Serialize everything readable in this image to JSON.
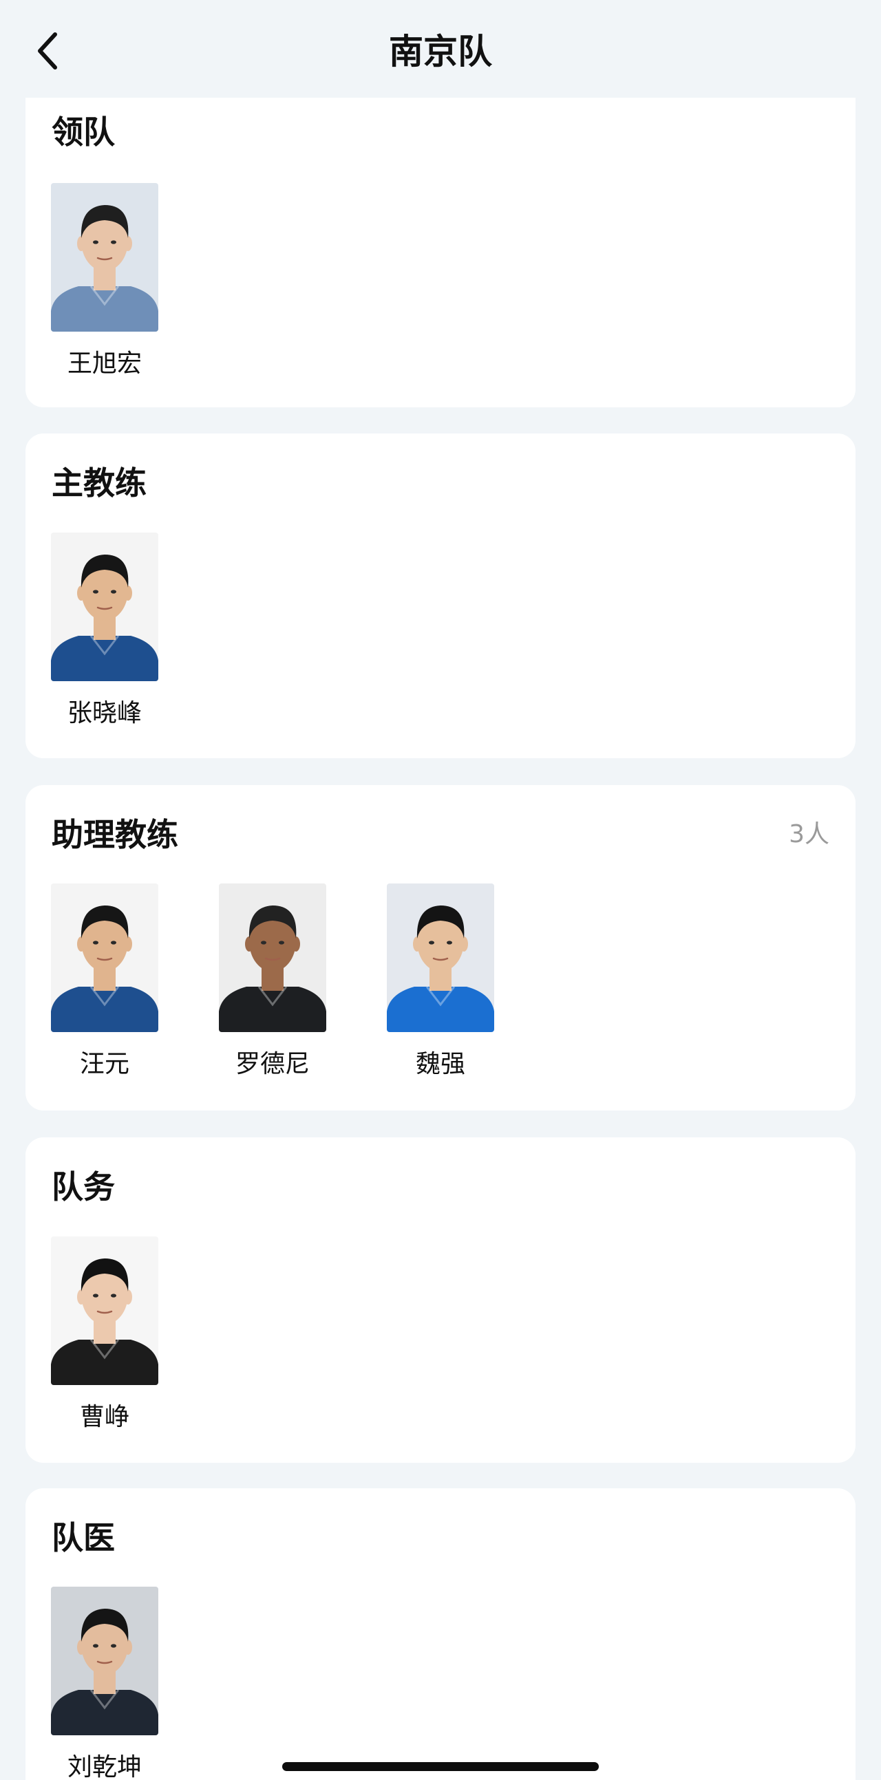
{
  "nav": {
    "title": "南京队",
    "back_icon": "back-arrow-icon"
  },
  "sections": [
    {
      "title": "领队",
      "count": "",
      "members": [
        {
          "name": "王旭宏",
          "bg": "#dde4ec",
          "shirt": "#6f8fb8",
          "hair": "#1f1f1f",
          "skin": "#e8c4a8"
        }
      ]
    },
    {
      "title": "主教练",
      "count": "",
      "members": [
        {
          "name": "张晓峰",
          "bg": "#f4f4f4",
          "shirt": "#1e4f8f",
          "hair": "#161616",
          "skin": "#e2b791"
        }
      ]
    },
    {
      "title": "助理教练",
      "count": "3人",
      "members": [
        {
          "name": "汪元",
          "bg": "#f4f4f4",
          "shirt": "#1e4f8f",
          "hair": "#161616",
          "skin": "#e0b48e"
        },
        {
          "name": "罗德尼",
          "bg": "#ededed",
          "shirt": "#1d1f22",
          "hair": "#222222",
          "skin": "#9c6a4a"
        },
        {
          "name": "魏强",
          "bg": "#e4e8ee",
          "shirt": "#1b6fd1",
          "hair": "#141414",
          "skin": "#e6bf9c"
        }
      ]
    },
    {
      "title": "队务",
      "count": "",
      "members": [
        {
          "name": "曹峥",
          "bg": "#f6f6f6",
          "shirt": "#1c1c1c",
          "hair": "#121212",
          "skin": "#ecc9ae"
        }
      ]
    },
    {
      "title": "队医",
      "count": "",
      "members": [
        {
          "name": "刘乾坤",
          "bg": "#cfd3d8",
          "shirt": "#1f2733",
          "hair": "#151515",
          "skin": "#e3bc9d"
        }
      ]
    }
  ]
}
